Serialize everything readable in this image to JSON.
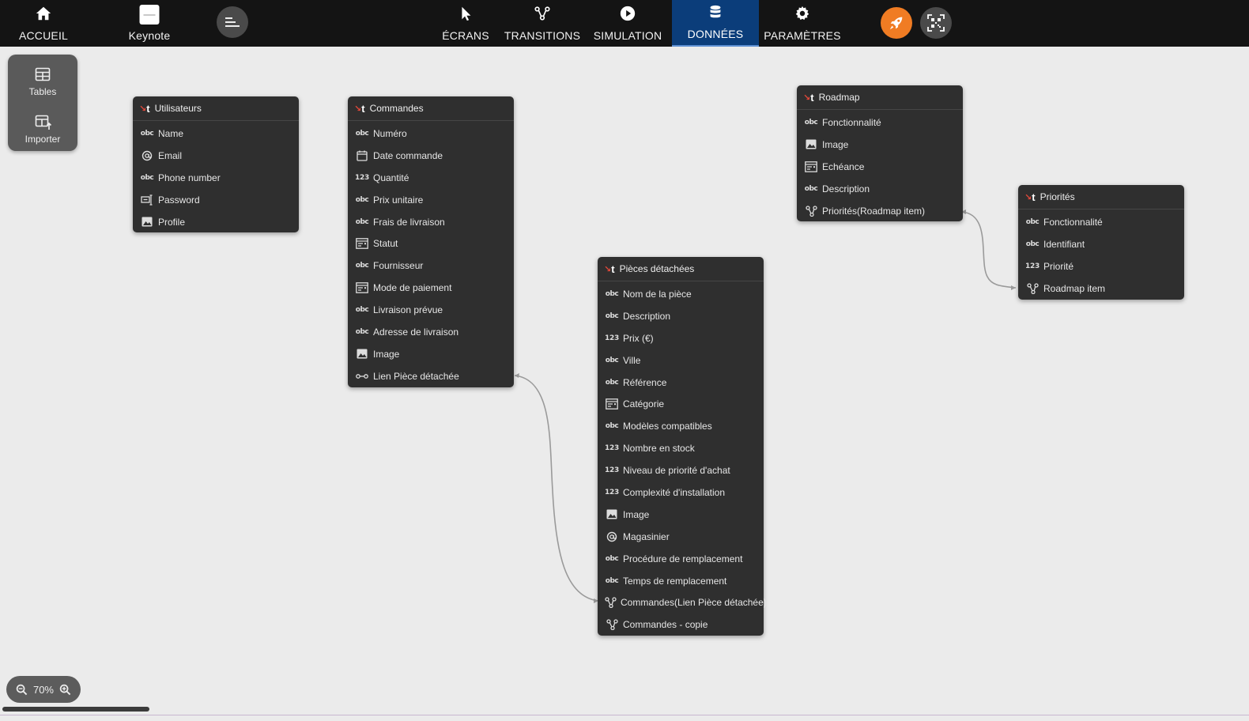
{
  "topbar": {
    "home_label": "ACCUEIL",
    "project_name": "Keynote",
    "nav": [
      {
        "label": "ÉCRANS",
        "icon": "cursor-icon"
      },
      {
        "label": "TRANSITIONS",
        "icon": "transitions-icon"
      },
      {
        "label": "SIMULATION",
        "icon": "play-icon"
      },
      {
        "label": "DONNÉES",
        "icon": "database-icon",
        "active": true
      },
      {
        "label": "PARAMÈTRES",
        "icon": "gear-icon"
      }
    ],
    "colors": {
      "background": "#141414",
      "active_tab": "#0b3d7a",
      "publish": "#f07c23"
    }
  },
  "lefttool": {
    "tables_label": "Tables",
    "import_label": "Importer"
  },
  "tables": [
    {
      "name": "Utilisateurs",
      "fields": [
        {
          "type": "text",
          "name": "Name"
        },
        {
          "type": "email",
          "name": "Email"
        },
        {
          "type": "text",
          "name": "Phone number"
        },
        {
          "type": "password",
          "name": "Password"
        },
        {
          "type": "image",
          "name": "Profile"
        }
      ]
    },
    {
      "name": "Commandes",
      "fields": [
        {
          "type": "text",
          "name": "Numéro"
        },
        {
          "type": "date",
          "name": "Date commande"
        },
        {
          "type": "number",
          "name": "Quantité"
        },
        {
          "type": "text",
          "name": "Prix unitaire"
        },
        {
          "type": "text",
          "name": "Frais de livraison"
        },
        {
          "type": "list",
          "name": "Statut"
        },
        {
          "type": "text",
          "name": "Fournisseur"
        },
        {
          "type": "list",
          "name": "Mode de paiement"
        },
        {
          "type": "text",
          "name": "Livraison prévue"
        },
        {
          "type": "text",
          "name": "Adresse de livraison"
        },
        {
          "type": "image",
          "name": "Image"
        },
        {
          "type": "link",
          "name": "Lien Pièce détachée"
        }
      ]
    },
    {
      "name": "Pièces détachées",
      "fields": [
        {
          "type": "text",
          "name": "Nom de la pièce"
        },
        {
          "type": "text",
          "name": "Description"
        },
        {
          "type": "number",
          "name": "Prix (€)"
        },
        {
          "type": "text",
          "name": "Ville"
        },
        {
          "type": "text",
          "name": "Référence"
        },
        {
          "type": "list",
          "name": "Catégorie"
        },
        {
          "type": "text",
          "name": "Modèles compatibles"
        },
        {
          "type": "number",
          "name": "Nombre en stock"
        },
        {
          "type": "number",
          "name": "Niveau de priorité d'achat"
        },
        {
          "type": "number",
          "name": "Complexité d'installation"
        },
        {
          "type": "image",
          "name": "Image"
        },
        {
          "type": "email",
          "name": "Magasinier"
        },
        {
          "type": "text",
          "name": "Procédure de remplacement"
        },
        {
          "type": "text",
          "name": "Temps de remplacement"
        },
        {
          "type": "relation",
          "name": "Commandes(Lien Pièce détachée)"
        },
        {
          "type": "relation",
          "name": "Commandes - copie"
        }
      ]
    },
    {
      "name": "Roadmap",
      "fields": [
        {
          "type": "text",
          "name": "Fonctionnalité"
        },
        {
          "type": "image",
          "name": "Image"
        },
        {
          "type": "list",
          "name": "Echéance"
        },
        {
          "type": "text",
          "name": "Description"
        },
        {
          "type": "relation",
          "name": "Priorités(Roadmap item)"
        }
      ]
    },
    {
      "name": "Priorités",
      "fields": [
        {
          "type": "text",
          "name": "Fonctionnalité"
        },
        {
          "type": "text",
          "name": "Identifiant"
        },
        {
          "type": "number",
          "name": "Priorité"
        },
        {
          "type": "relation",
          "name": "Roadmap item"
        }
      ]
    }
  ],
  "zoom": {
    "level": "70%"
  }
}
